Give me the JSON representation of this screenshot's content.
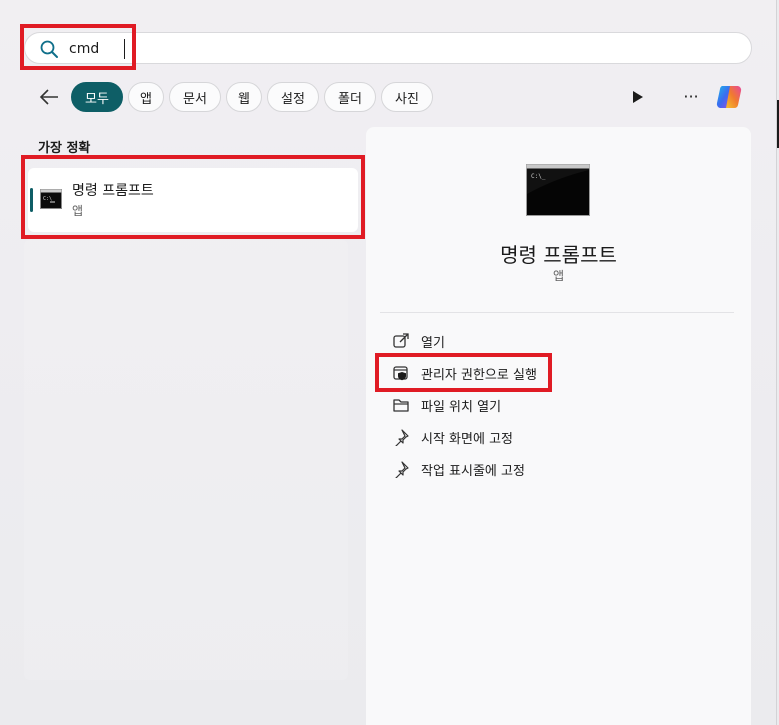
{
  "search": {
    "value": "cmd",
    "placeholder": ""
  },
  "filters": [
    {
      "label": "모두",
      "active": true
    },
    {
      "label": "앱",
      "active": false
    },
    {
      "label": "문서",
      "active": false
    },
    {
      "label": "웹",
      "active": false
    },
    {
      "label": "설정",
      "active": false
    },
    {
      "label": "폴더",
      "active": false
    },
    {
      "label": "사진",
      "active": false
    }
  ],
  "icons": {
    "search": "search-icon",
    "back": "arrow-left-icon",
    "play": "play-icon",
    "more": "more-icon",
    "copilot": "copilot-icon",
    "app": "terminal-icon",
    "open": "open-external-icon",
    "admin": "shield-icon",
    "folder": "folder-icon",
    "pin": "pin-icon"
  },
  "more_label": "···",
  "best_match": {
    "heading": "가장 정확",
    "title": "명령 프롬프트",
    "type": "앱"
  },
  "detail": {
    "title": "명령 프롬프트",
    "type": "앱",
    "actions": [
      {
        "label": "열기"
      },
      {
        "label": "관리자 권한으로 실행"
      },
      {
        "label": "파일 위치 열기"
      },
      {
        "label": "시작 화면에 고정"
      },
      {
        "label": "작업 표시줄에 고정"
      }
    ]
  },
  "colors": {
    "accent": "#0e5e66",
    "annotation": "#e01b24"
  }
}
